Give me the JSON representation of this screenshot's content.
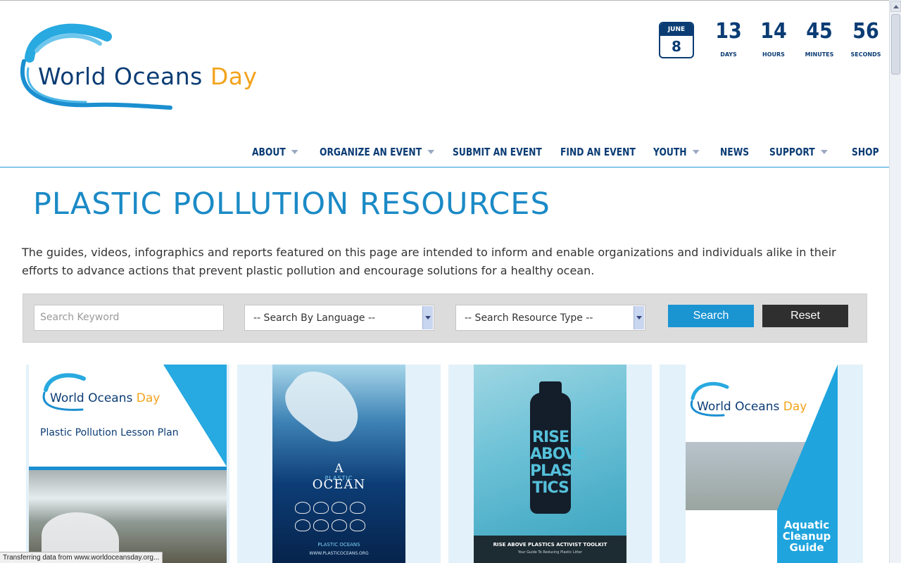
{
  "header": {
    "logo": {
      "word1": "World Oceans",
      "word2": "Day"
    },
    "countdown": {
      "month": "JUNE",
      "day": "8",
      "units": [
        {
          "value": "13",
          "label": "DAYS"
        },
        {
          "value": "14",
          "label": "HOURS"
        },
        {
          "value": "45",
          "label": "MINUTES"
        },
        {
          "value": "56",
          "label": "SECONDS"
        }
      ]
    },
    "nav": [
      {
        "label": "ABOUT",
        "dropdown": true
      },
      {
        "label": "ORGANIZE AN EVENT",
        "dropdown": true
      },
      {
        "label": "SUBMIT AN EVENT",
        "dropdown": false
      },
      {
        "label": "FIND AN EVENT",
        "dropdown": false
      },
      {
        "label": "YOUTH",
        "dropdown": true
      },
      {
        "label": "NEWS",
        "dropdown": false
      },
      {
        "label": "SUPPORT",
        "dropdown": true
      },
      {
        "label": "SHOP",
        "dropdown": false
      }
    ]
  },
  "main": {
    "title": "PLASTIC POLLUTION RESOURCES",
    "intro": "The guides, videos, infographics and reports featured on this page are intended to inform and enable organizations and individuals alike in their efforts to advance actions that prevent plastic pollution and encourage solutions for a healthy ocean."
  },
  "filters": {
    "search_placeholder": "Search Keyword",
    "language_select": "-- Search By Language --",
    "type_select": "-- Search Resource Type --",
    "search_button": "Search",
    "reset_button": "Reset"
  },
  "cards": [
    {
      "logo_word1": "World Oceans",
      "logo_word2": "Day",
      "subtitle": "Plastic Pollution Lesson Plan"
    },
    {
      "title_a": "A",
      "title_plastic": "PLASTIC",
      "title_ocean": "OCEAN",
      "brand": "PLASTIC OCEANS",
      "url": "WWW.PLASTICOCEANS.ORG"
    },
    {
      "bottle_text": "RISE ABOVE PLAS TICS",
      "footer_title": "RISE ABOVE PLASTICS ACTIVIST TOOLKIT",
      "footer_sub": "Your Guide To Reducing Plastic Litter"
    },
    {
      "logo_word1": "World Oceans",
      "logo_word2": "Day",
      "title": "Aquatic Cleanup Guide"
    }
  ],
  "status_bar": "Transferring data from www.worldoceansday.org...",
  "colors": {
    "brand_navy": "#0b3c74",
    "brand_blue": "#1b8ac6",
    "accent_orange": "#f3a31c",
    "search_button": "#1b94d2",
    "reset_button": "#2f2f2f"
  }
}
